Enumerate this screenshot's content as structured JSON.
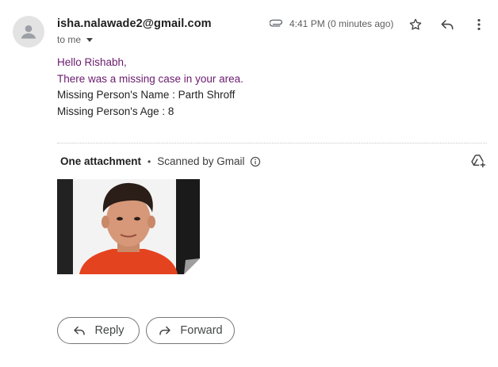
{
  "email": {
    "sender": "isha.nalawade2@gmail.com",
    "recipient_label": "to me",
    "time": "4:41 PM (0 minutes ago)",
    "body": {
      "greeting": "Hello Rishabh,",
      "line1": "There was a missing case in your area.",
      "line2": "Missing Person's Name : Parth Shroff",
      "line3": "Missing Person's Age : 8"
    }
  },
  "attachments": {
    "title": "One attachment",
    "separator": "•",
    "scanned_label": "Scanned by Gmail"
  },
  "actions": {
    "reply_label": "Reply",
    "forward_label": "Forward"
  },
  "icons": [
    "avatar-person-icon",
    "paperclip-icon",
    "star-icon",
    "reply-icon",
    "more-vert-icon",
    "info-icon",
    "add-to-drive-icon",
    "reply-arrow-icon",
    "forward-arrow-icon"
  ],
  "colors": {
    "body_text_accent": "#6a1b6e",
    "button_border": "#747775",
    "avatar_bg": "#e3e3e3"
  }
}
